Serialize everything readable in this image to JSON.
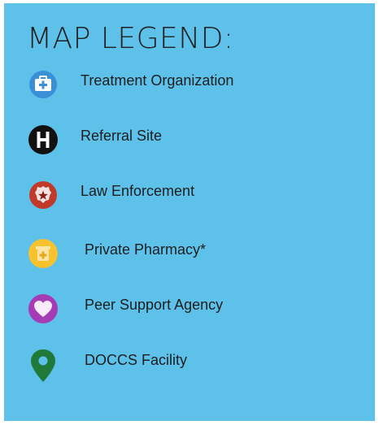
{
  "legend": {
    "title": "MAP LEGEND:",
    "items": [
      {
        "label": "Treatment Organization",
        "icon": "medical-briefcase-icon",
        "color": "#3b8fd6"
      },
      {
        "label": "Referral Site",
        "icon": "hospital-h-icon",
        "color": "#111111"
      },
      {
        "label": "Law Enforcement",
        "icon": "police-badge-icon",
        "color": "#c0392b"
      },
      {
        "label": "Private Pharmacy*",
        "icon": "pharmacy-mortar-icon",
        "color": "#f7c22e"
      },
      {
        "label": "Peer Support Agency",
        "icon": "heart-icon",
        "color": "#a63bb6"
      },
      {
        "label": "DOCCS Facility",
        "icon": "map-pin-icon",
        "color": "#1f7a3a"
      }
    ]
  }
}
